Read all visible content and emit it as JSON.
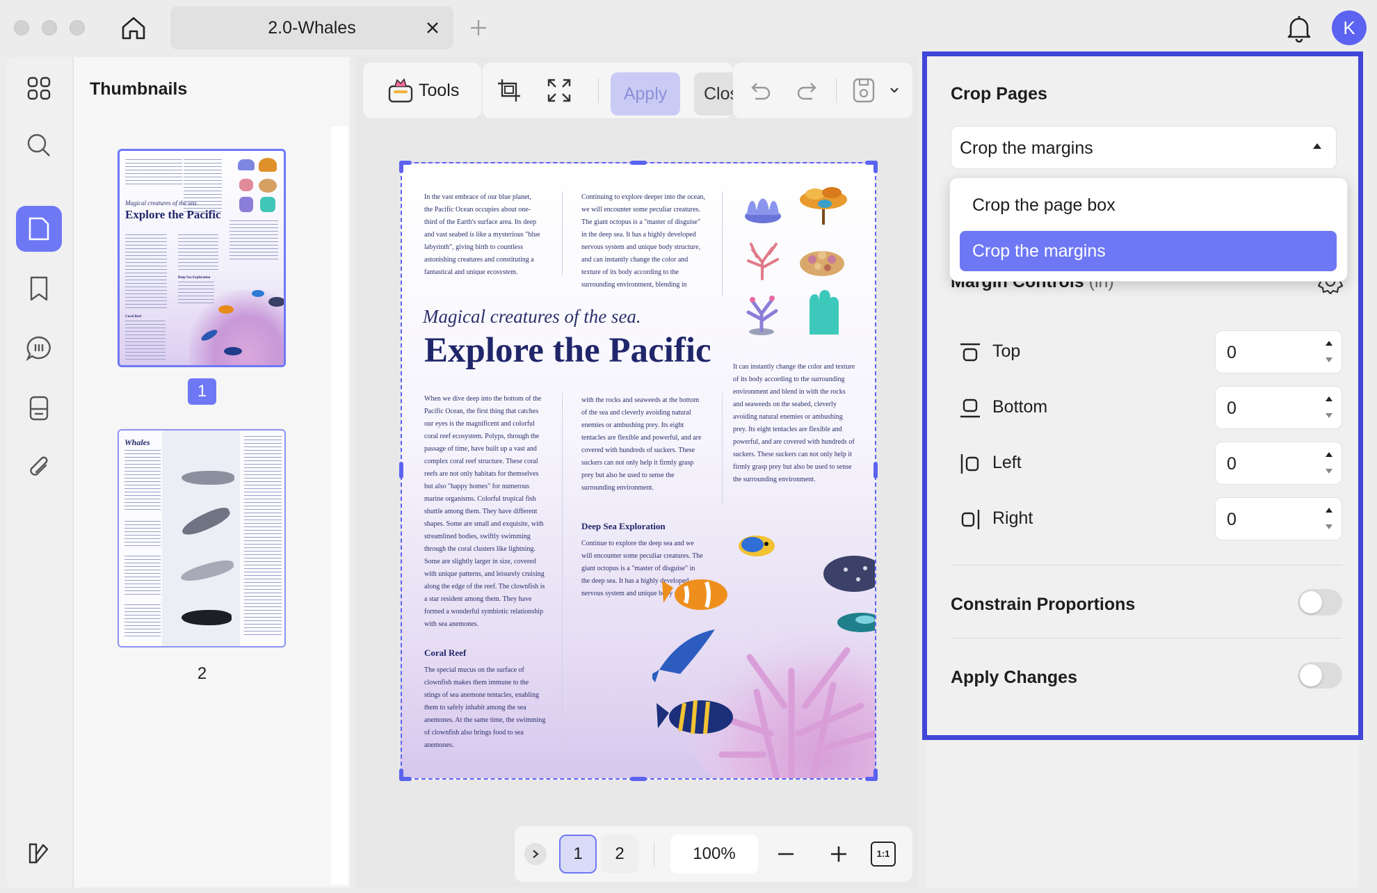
{
  "titlebar": {
    "tab_title": "2.0-Whales",
    "avatar_initial": "K"
  },
  "sidebar": {
    "items": [
      {
        "name": "apps-grid-icon"
      },
      {
        "name": "search-icon"
      },
      {
        "name": "page-icon",
        "active": true
      },
      {
        "name": "bookmark-icon"
      },
      {
        "name": "comment-icon"
      },
      {
        "name": "form-icon"
      },
      {
        "name": "attachment-icon"
      }
    ]
  },
  "thumbnails": {
    "title": "Thumbnails",
    "pages": [
      "1",
      "2"
    ],
    "selected": "1",
    "thumb1": {
      "subtitle": "Magical creatures of the sea.",
      "title": "Explore the Pacific",
      "heading_a": "Deep Sea Exploration",
      "heading_b": "Coral Reef"
    },
    "thumb2": {
      "title": "Whales"
    }
  },
  "toolbar": {
    "tools_label": "Tools",
    "apply_label": "Apply",
    "close_label": "Close"
  },
  "page": {
    "col1_top": "In the vast embrace of our blue planet, the Pacific Ocean occupies about one-third of the Earth's surface area. Its deep and vast seabed is like a mysterious \"blue labyrinth\", giving birth to countless astonishing creatures and constituting a fantastical and unique ecosystem.",
    "col2_top": "Continuing to explore deeper into the ocean, we will encounter some peculiar creatures. The giant octopus is a \"master of disguise\" in the deep sea. It has a highly developed nervous system and unique body structure, and can instantly change the color and texture of its body according to the surrounding environment, blending in",
    "subtitle": "Magical creatures of the sea.",
    "title": "Explore the Pacific",
    "col3_mid": "It can instantly change the color and texture of its body according to the surrounding environment and blend in with the rocks and seaweeds on the seabed, cleverly avoiding natural enemies or ambushing prey. Its eight tentacles are flexible and powerful, and are covered with hundreds of suckers. These suckers can not only help it firmly grasp prey but also be used to sense the surrounding environment.",
    "col1_mid": "When we dive deep into the bottom of the Pacific Ocean, the first thing that catches our eyes is the magnificent and colorful coral reef ecosystem. Polyps, through the passage of time, have built up a vast and complex coral reef structure. These coral reefs are not only habitats for themselves but also \"happy homes\" for numerous marine organisms. Colorful tropical fish shuttle among them. They have different shapes. Some are small and exquisite, with streamlined bodies, swiftly swimming through the coral clusters like lightning. Some are slightly larger in size, covered with unique patterns, and leisurely cruising along the edge of the reef. The clownfish is a star resident among them. They have formed a wonderful symbiotic relationship with sea anemones.",
    "col2_mid": "with the rocks and seaweeds at the bottom of the sea and cleverly avoiding natural enemies or ambushing prey. Its eight tentacles are flexible and powerful, and are covered with hundreds of suckers. These suckers can not only help it firmly grasp prey but also be used to sense the surrounding environment.",
    "heading_deep": "Deep Sea Exploration",
    "deep_text": "Continue to explore the deep sea and we will encounter some peculiar creatures. The giant octopus is a \"master of disguise\" in the deep sea. It has a highly developed nervous system and unique body structure.",
    "heading_coral": "Coral Reef",
    "coral_text": "The special mucus on the surface of clownfish makes them immune to the stings of sea anemone tentacles, enabling them to safely inhabit among the sea anemones. At the same time, the swimming of clownfish also brings food to sea anemones."
  },
  "pager": {
    "pages": [
      "1",
      "2"
    ],
    "current": "1",
    "zoom": "100%",
    "fit_label": "1:1"
  },
  "crop_panel": {
    "title": "Crop Pages",
    "mode_value": "Crop the margins",
    "options": [
      "Crop the page box",
      "Crop the margins"
    ],
    "selected_option": "Crop the margins",
    "margin_controls_label": "Margin Controls",
    "margin_unit": "(in)",
    "margins": [
      {
        "label": "Top",
        "value": "0"
      },
      {
        "label": "Bottom",
        "value": "0"
      },
      {
        "label": "Left",
        "value": "0"
      },
      {
        "label": "Right",
        "value": "0"
      }
    ],
    "constrain_label": "Constrain Proportions",
    "constrain_on": false,
    "apply_changes_label": "Apply Changes",
    "apply_changes_on": false
  },
  "colors": {
    "accent": "#6e78f5",
    "panel_border": "#3f46d8",
    "page_text": "#2a2f6a"
  }
}
